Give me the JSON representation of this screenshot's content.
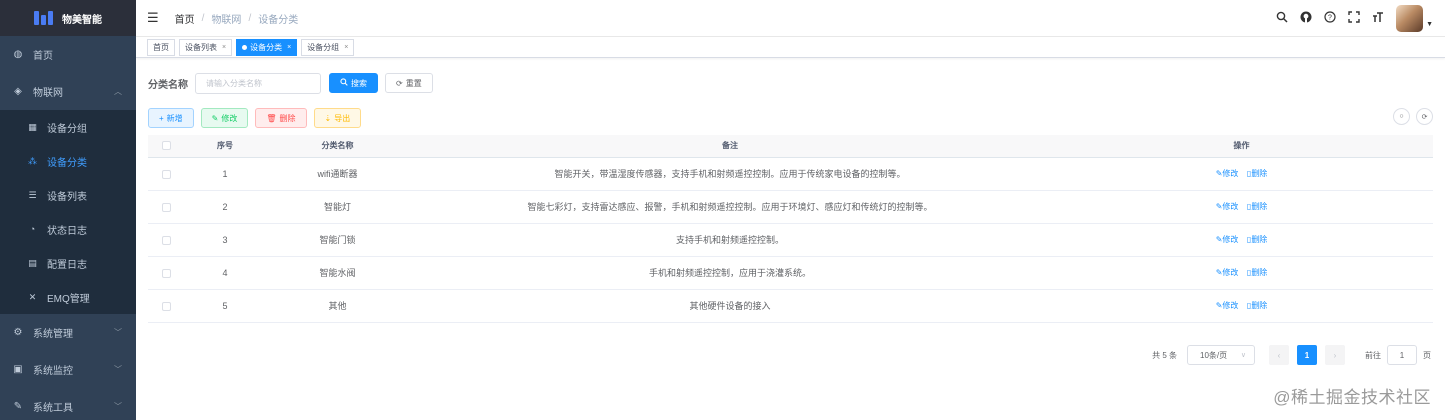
{
  "app": {
    "title": "物美智能"
  },
  "sidebar": {
    "items": [
      {
        "label": "首页",
        "icon": "dashboard-icon"
      },
      {
        "label": "物联网",
        "icon": "iot-icon",
        "expanded": true
      },
      {
        "label": "系统管理",
        "icon": "gear-icon"
      },
      {
        "label": "系统监控",
        "icon": "monitor-icon"
      },
      {
        "label": "系统工具",
        "icon": "tool-icon"
      }
    ],
    "sub_items": [
      {
        "label": "设备分组",
        "icon": "grid-icon"
      },
      {
        "label": "设备分类",
        "icon": "tree-icon",
        "active": true
      },
      {
        "label": "设备列表",
        "icon": "list-icon"
      },
      {
        "label": "状态日志",
        "icon": "log-icon"
      },
      {
        "label": "配置日志",
        "icon": "config-icon"
      },
      {
        "label": "EMQ管理",
        "icon": "cross-icon"
      }
    ]
  },
  "breadcrumb": [
    "首页",
    "物联网",
    "设备分类"
  ],
  "tags": [
    {
      "label": "首页",
      "closable": false
    },
    {
      "label": "设备列表",
      "closable": true
    },
    {
      "label": "设备分类",
      "closable": true,
      "active": true
    },
    {
      "label": "设备分组",
      "closable": true
    }
  ],
  "search": {
    "label": "分类名称",
    "placeholder": "请输入分类名称",
    "search_btn": "搜索",
    "reset_btn": "重置"
  },
  "toolbar": {
    "add": "新增",
    "edit": "修改",
    "delete": "删除",
    "export": "导出"
  },
  "table": {
    "headers": [
      "序号",
      "分类名称",
      "备注",
      "操作"
    ],
    "rows": [
      {
        "no": "1",
        "name": "wifi通断器",
        "remark": "智能开关，带温湿度传感器，支持手机和射频遥控控制。应用于传统家电设备的控制等。"
      },
      {
        "no": "2",
        "name": "智能灯",
        "remark": "智能七彩灯，支持雷达感应、报警，手机和射频遥控控制。应用于环境灯、感应灯和传统灯的控制等。"
      },
      {
        "no": "3",
        "name": "智能门锁",
        "remark": "支持手机和射频遥控控制。"
      },
      {
        "no": "4",
        "name": "智能水阀",
        "remark": "手机和射频遥控控制，应用于浇灌系统。"
      },
      {
        "no": "5",
        "name": "其他",
        "remark": "其他硬件设备的接入"
      }
    ],
    "op_edit": "修改",
    "op_delete": "删除"
  },
  "pagination": {
    "total": "共 5 条",
    "page_size": "10条/页",
    "current": "1",
    "goto_label": "前往",
    "goto_value": "1",
    "page_suffix": "页"
  },
  "watermark": "@稀土掘金技术社区",
  "colors": {
    "sidebar_bg": "#304156",
    "accent": "#1890ff",
    "active_menu": "#409eff"
  }
}
